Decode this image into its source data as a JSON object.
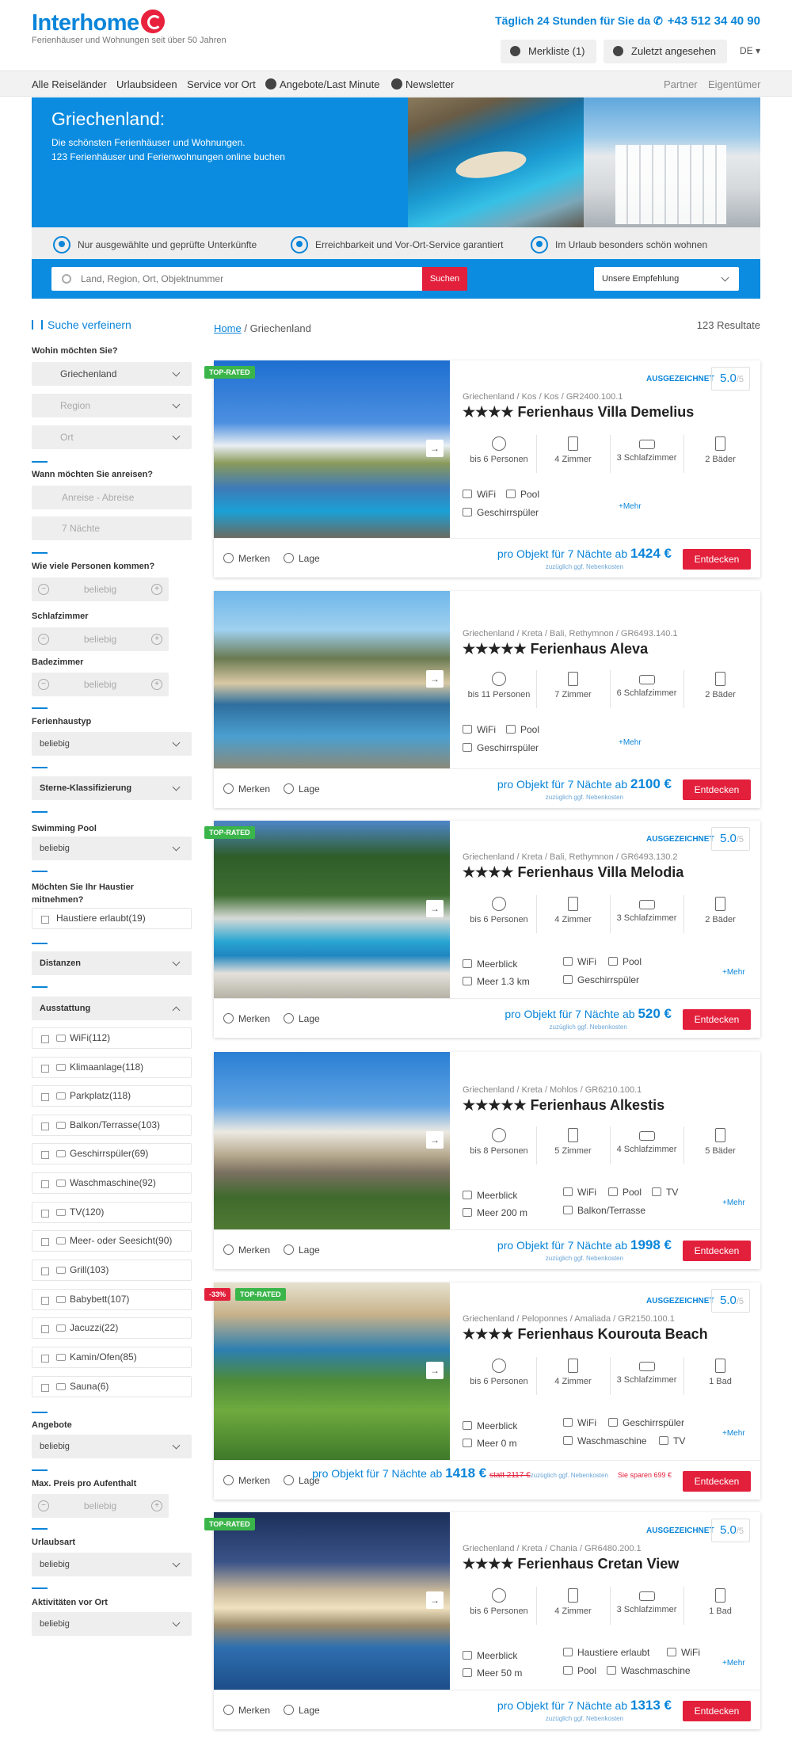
{
  "header": {
    "logo": "Interhome",
    "tagline": "Ferienhäuser und Wohnungen seit über 50 Jahren",
    "hotline_label": "Täglich 24 Stunden für Sie da",
    "hotline_number": "+43 512 34 40 90",
    "watchlist": "Merkliste (1)",
    "recent": "Zuletzt angesehen",
    "language": "DE ▾"
  },
  "nav": {
    "items": [
      "Alle Reiseländer",
      "Urlaubsideen",
      "Service vor Ort",
      "Angebote/Last Minute",
      "Newsletter"
    ],
    "right": [
      "Partner",
      "Eigentümer"
    ]
  },
  "hero": {
    "title": "Griechenland:",
    "sub1": "Die schönsten Ferienhäuser und Wohnungen.",
    "sub2": "123 Ferienhäuser und Ferienwohnungen online buchen"
  },
  "usps": [
    "Nur ausgewählte und geprüfte Unterkünfte",
    "Erreichbarkeit und Vor-Ort-Service garantiert",
    "Im Urlaub besonders schön wohnen"
  ],
  "search": {
    "placeholder": "Land, Region, Ort, Objektnummer",
    "button": "Suchen",
    "sort": "Unsere Empfehlung"
  },
  "sidebar": {
    "title": "Suche verfeinern",
    "where_label": "Wohin möchten Sie?",
    "country": "Griechenland",
    "region": "Region",
    "place": "Ort",
    "when_label": "Wann möchten Sie anreisen?",
    "dates": "Anreise - Abreise",
    "nights": "7 Nächte",
    "persons_label": "Wie viele Personen kommen?",
    "any": "beliebig",
    "bedrooms_label": "Schlafzimmer",
    "bathrooms_label": "Badezimmer",
    "type_label": "Ferienhaustyp",
    "stars_label": "Sterne-Klassifizierung",
    "pool_label": "Swimming Pool",
    "pet_label1": "Möchten Sie Ihr Haustier",
    "pet_label2": "mitnehmen?",
    "pet_option": "Haustiere erlaubt(19)",
    "distances": "Distanzen",
    "equipment": "Ausstattung",
    "equipment_items": [
      "WiFi(112)",
      "Klimaanlage(118)",
      "Parkplatz(118)",
      "Balkon/Terrasse(103)",
      "Geschirrspüler(69)",
      "Waschmaschine(92)",
      "TV(120)",
      "Meer- oder Seesicht(90)",
      "Grill(103)",
      "Babybett(107)",
      "Jacuzzi(22)",
      "Kamin/Ofen(85)",
      "Sauna(6)"
    ],
    "offers_label": "Angebote",
    "maxprice_label": "Max. Preis pro Aufenthalt",
    "holiday_label": "Urlaubsart",
    "activities_label": "Aktivitäten vor Ort"
  },
  "results": {
    "home": "Home",
    "separator": "/",
    "current": "Griechenland",
    "count": "123 Resultate",
    "rated_label": "AUSGEZEICHNET",
    "rating_of": "/5",
    "top_rated": "TOP-RATED",
    "merken": "Merken",
    "lage": "Lage",
    "discover": "Entdecken",
    "price_prefix": "pro Objekt für 7 Nächte ab",
    "price_extra": "zuzüglich ggf. Nebenkosten",
    "mehr": "+Mehr",
    "listings": [
      {
        "loc": "Griechenland  /  Kos  /  Kos  /   GR2400.100.1",
        "name": "★★★★ Ferienhaus Villa Demelius",
        "persons": "bis 6 Personen",
        "rooms": "4 Zimmer",
        "bedrooms": "3 Schlafzimmer",
        "baths": "2 Bäder",
        "rating": "5.0",
        "price": "1424 €",
        "a1": "WiFi",
        "a2": "Pool",
        "a3": "Geschirrspüler"
      },
      {
        "loc": "Griechenland  /  Kreta  /  Bali, Rethymnon  /   GR6493.140.1",
        "name": "★★★★★ Ferienhaus Aleva",
        "persons": "bis 11 Personen",
        "rooms": "7 Zimmer",
        "bedrooms": "6 Schlafzimmer",
        "baths": "2 Bäder",
        "price": "2100 €",
        "a1": "WiFi",
        "a2": "Pool",
        "a3": "Geschirrspüler"
      },
      {
        "loc": "Griechenland  /  Kreta  /  Bali, Rethymnon  /   GR6493.130.2",
        "name": "★★★★ Ferienhaus Villa Melodia",
        "persons": "bis 6 Personen",
        "rooms": "4 Zimmer",
        "bedrooms": "3 Schlafzimmer",
        "baths": "2 Bäder",
        "rating": "5.0",
        "price": "520 €",
        "a1": "Meerblick",
        "a2": "Meer 1.3 km",
        "a3": "WiFi",
        "a4": "Pool",
        "a5": "Geschirrspüler"
      },
      {
        "loc": "Griechenland  /  Kreta  /  Mohlos  /   GR6210.100.1",
        "name": "★★★★★ Ferienhaus Alkestis",
        "persons": "bis 8 Personen",
        "rooms": "5 Zimmer",
        "bedrooms": "4 Schlafzimmer",
        "baths": "5 Bäder",
        "price": "1998 €",
        "a1": "Meerblick",
        "a2": "Meer 200 m",
        "a3": "WiFi",
        "a4": "Pool",
        "a5": "TV",
        "a6": "Balkon/Terrasse"
      },
      {
        "loc": "Griechenland  /  Peloponnes  /  Amaliada  /   GR2150.100.1",
        "name": "★★★★ Ferienhaus Kourouta Beach",
        "persons": "bis 6 Personen",
        "rooms": "4 Zimmer",
        "bedrooms": "3 Schlafzimmer",
        "baths": "1 Bad",
        "rating": "5.0",
        "price": "1418 €",
        "old_price": "statt 2117 €",
        "save": "Sie sparen 699 €",
        "discount": "-33%",
        "a1": "Meerblick",
        "a2": "Meer 0 m",
        "a3": "WiFi",
        "a4": "Geschirrspüler",
        "a5": "Waschmaschine",
        "a6": "TV"
      },
      {
        "loc": "Griechenland  /  Kreta  /  Chania  /   GR6480.200.1",
        "name": "★★★★ Ferienhaus Cretan View",
        "persons": "bis 6 Personen",
        "rooms": "4 Zimmer",
        "bedrooms": "3 Schlafzimmer",
        "baths": "1 Bad",
        "rating": "5.0",
        "price": "1313 €",
        "a1": "Meerblick",
        "a2": "Meer 50 m",
        "a3": "Haustiere erlaubt",
        "a4": "WiFi",
        "a5": "Pool",
        "a6": "Waschmaschine"
      }
    ]
  },
  "colors": {
    "brand": "#0a85d9",
    "accent": "#e3203c",
    "top_rated": "#3ab54a"
  }
}
